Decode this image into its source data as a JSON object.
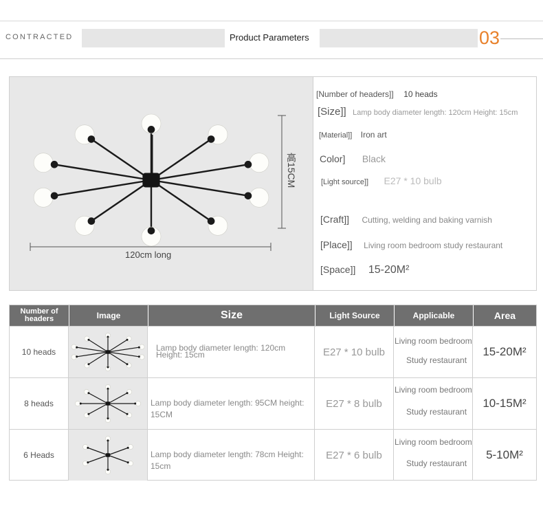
{
  "header": {
    "left_label": "CONTRACTED",
    "title": "Product Parameters",
    "number": "03",
    "accent": "#e8812b"
  },
  "product_image": {
    "width_label": "120cm long",
    "height_label": "高15CM"
  },
  "params": [
    {
      "key": "[Number of headers]]",
      "value": "10 heads"
    },
    {
      "key": "[Size]]",
      "value": "Lamp body diameter length: 120cm Height: 15cm"
    },
    {
      "key": "[Material]]",
      "value": "Iron art"
    },
    {
      "key": "Color]",
      "value": "Black"
    },
    {
      "key": "[Light source]]",
      "value": "E27 * 10 bulb"
    },
    {
      "key": "[Craft]]",
      "value": "Cutting, welding and baking varnish"
    },
    {
      "key": "[Place]]",
      "value": "Living room bedroom study restaurant"
    },
    {
      "key": "[Space]]",
      "value": "15-20M²"
    }
  ],
  "table": {
    "headers": [
      "Number of headers",
      "Image",
      "Size",
      "Light Source",
      "Applicable",
      "Area"
    ],
    "rows": [
      {
        "heads": "10 heads",
        "size_line1": "Lamp body diameter length: 120cm",
        "size_line2": "Height: 15cm",
        "source": "E27 * 10 bulb",
        "app_line1": "Living room bedroom",
        "app_line2": "Study restaurant",
        "area": "15-20M²",
        "arms": 10
      },
      {
        "heads": "8 heads",
        "size_line1": "Lamp body diameter length: 95CM height:",
        "size_line2": "15CM",
        "source": "E27 * 8 bulb",
        "app_line1": "Living room bedroom",
        "app_line2": "Study restaurant",
        "area": "10-15M²",
        "arms": 8
      },
      {
        "heads": "6 Heads",
        "size_line1": "Lamp body diameter length: 78cm Height:",
        "size_line2": "15cm",
        "source": "E27 * 6 bulb",
        "app_line1": "Living room bedroom",
        "app_line2": "Study restaurant",
        "area": "5-10M²",
        "arms": 6
      }
    ]
  }
}
